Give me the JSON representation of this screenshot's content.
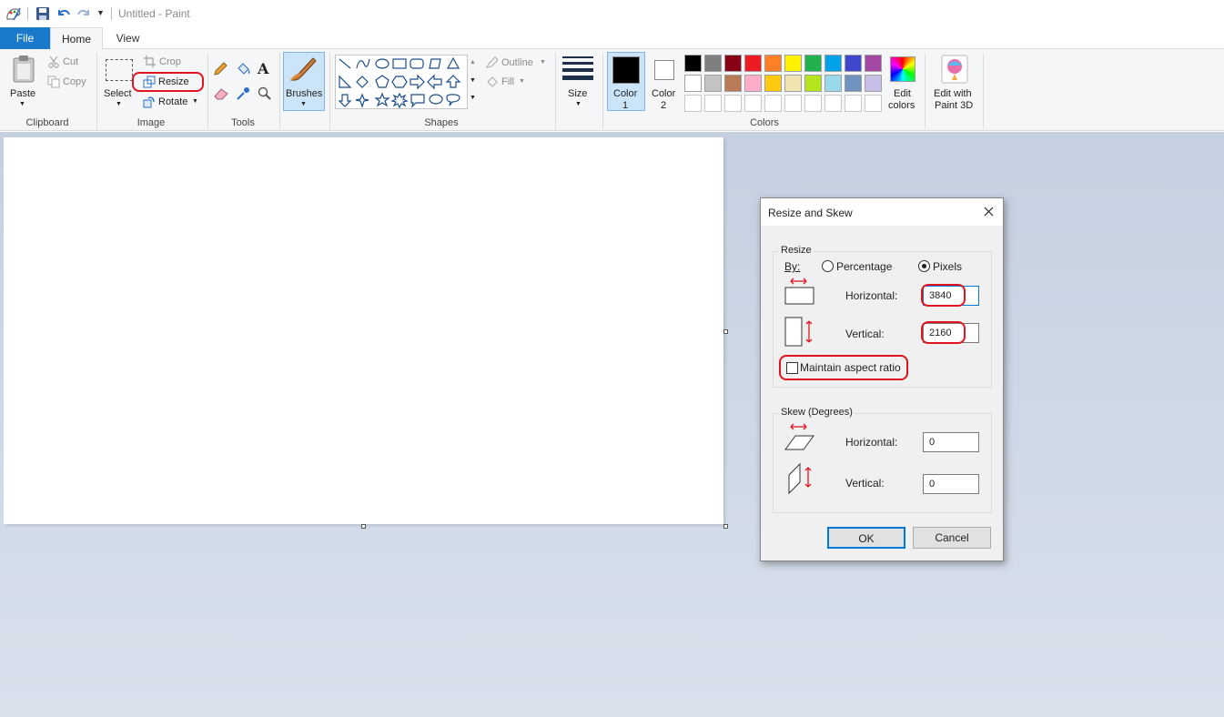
{
  "window": {
    "title": "Untitled - Paint"
  },
  "tabs": {
    "file": "File",
    "home": "Home",
    "view": "View"
  },
  "ribbon": {
    "clipboard": {
      "paste": "Paste",
      "cut": "Cut",
      "copy": "Copy",
      "label": "Clipboard"
    },
    "image": {
      "select": "Select",
      "crop": "Crop",
      "resize": "Resize",
      "rotate": "Rotate",
      "label": "Image"
    },
    "tools": {
      "label": "Tools"
    },
    "brushes": {
      "label": "Brushes"
    },
    "shapes": {
      "label": "Shapes",
      "outline": "Outline",
      "fill": "Fill"
    },
    "size": {
      "label": "Size"
    },
    "colors": {
      "color1": "Color",
      "color1_num": "1",
      "color2": "Color",
      "color2_num": "2",
      "edit_colors_1": "Edit",
      "edit_colors_2": "colors",
      "edit_3d_1": "Edit with",
      "edit_3d_2": "Paint 3D",
      "label": "Colors",
      "color1_value": "#000000",
      "color2_value": "#ffffff",
      "palette_row1": [
        "#000000",
        "#7f7f7f",
        "#880015",
        "#ed1c24",
        "#ff7f27",
        "#fff200",
        "#22b14c",
        "#00a2e8",
        "#3f48cc",
        "#a349a4"
      ],
      "palette_row2": [
        "#ffffff",
        "#c3c3c3",
        "#b97a57",
        "#ffaec9",
        "#ffc90e",
        "#efe4b0",
        "#b5e61d",
        "#99d9ea",
        "#7092be",
        "#c8bfe7"
      ],
      "palette_row3": [
        "#ffffff",
        "#ffffff",
        "#ffffff",
        "#ffffff",
        "#ffffff",
        "#ffffff",
        "#ffffff",
        "#ffffff",
        "#ffffff",
        "#ffffff"
      ]
    }
  },
  "dialog": {
    "title": "Resize and Skew",
    "resize_legend": "Resize",
    "by": "By:",
    "percentage": "Percentage",
    "pixels": "Pixels",
    "horizontal_label": "Horizontal:",
    "vertical_label": "Vertical:",
    "horizontal_value": "3840",
    "vertical_value": "2160",
    "maintain": "Maintain aspect ratio",
    "skew_legend": "Skew (Degrees)",
    "skew_h_label": "Horizontal:",
    "skew_v_label": "Vertical:",
    "skew_h_value": "0",
    "skew_v_value": "0",
    "ok": "OK",
    "cancel": "Cancel"
  }
}
